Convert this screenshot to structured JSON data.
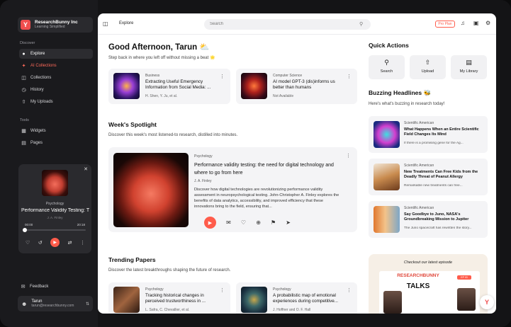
{
  "brand": {
    "logo_letter": "Y",
    "name": "ResearchBunny Inc",
    "tagline": "Learning Simplified"
  },
  "sidebar": {
    "discover_label": "Discover",
    "items": [
      {
        "label": "Explore",
        "icon": "compass-icon"
      },
      {
        "label": "AI Collections",
        "icon": "sparkle-icon"
      },
      {
        "label": "Collections",
        "icon": "folder-icon"
      },
      {
        "label": "History",
        "icon": "history-icon"
      },
      {
        "label": "My Uploads",
        "icon": "upload-icon"
      }
    ],
    "tools_label": "Tools",
    "tools": [
      {
        "label": "Widgets",
        "icon": "widget-icon"
      },
      {
        "label": "Pages",
        "icon": "page-icon"
      }
    ],
    "feedback_label": "Feedback",
    "user": {
      "name": "Tarun",
      "email": "tarun@researchbunny.com"
    }
  },
  "player": {
    "category": "Psychology",
    "title": "Performance Validity Testing: T",
    "author": "J. A. Finley",
    "time_current": "00:00",
    "time_total": "20:18",
    "progress": 0.0
  },
  "topbar": {
    "title": "Explore",
    "search_placeholder": "Search",
    "plan_label": "Pro Plan"
  },
  "greeting": {
    "title": "Good Afternoon, Tarun ⛅",
    "subtitle": "Step back in where you left off without missing a beat 🌟"
  },
  "recent": [
    {
      "category": "Business",
      "title": "Extracting Useful Emergency Information from Social Media: ...",
      "meta": "H. Shen, Y. Ju, et al."
    },
    {
      "category": "Computer Science",
      "title": "AI model GPT-3 (dis)informs us better than humans",
      "meta": "Not Available"
    }
  ],
  "spotlight": {
    "title": "Week's Spotlight",
    "subtitle": "Discover this week's most listened-to research, distilled into minutes.",
    "card": {
      "category": "Psychology",
      "title": "Performance validity testing: the need for digital technology and where to go from here",
      "author": "J. A. Finley",
      "description": "Discover how digital technologies are revolutionizing performance validity assessment in neuropsychological testing. John-Christopher A. Finley explores the benefits of data analytics, accessibility, and improved efficiency that these innovations bring to the field, ensuring that..."
    }
  },
  "trending": {
    "title": "Trending Papers",
    "subtitle": "Discover the latest breakthroughs shaping the future of research.",
    "items": [
      {
        "category": "Psychology",
        "title": "Tracking historical changes in perceived trustworthiness in ...",
        "meta": "L. Safra, C. Chevallier, et al."
      },
      {
        "category": "Psychology",
        "title": "A probabilistic map of emotional experiences during competitive...",
        "meta": "J. Hoffner and O. F. Hall"
      }
    ]
  },
  "quick_actions": {
    "title": "Quick Actions",
    "items": [
      {
        "label": "Search",
        "icon": "search-icon"
      },
      {
        "label": "Upload",
        "icon": "upload-icon"
      },
      {
        "label": "My Library",
        "icon": "library-icon"
      }
    ]
  },
  "headlines": {
    "title": "Buzzing Headlines 🐝",
    "subtitle": "Here's what's buzzing in research today!",
    "items": [
      {
        "source": "Scientific American",
        "title": "What Happens When an Entire Scientific Field Changes Its Mind",
        "desc": "If there is a promising gene for the Ag..."
      },
      {
        "source": "Scientific American",
        "title": "New Treatments Can Free Kids from the Deadly Threat of Peanut Allergy",
        "desc": "Remarkable new treatments can free..."
      },
      {
        "source": "Scientific American",
        "title": "Say Goodbye to Juno, NASA's Groundbreaking Mission to Jupiter",
        "desc": "The Juno spacecraft has rewritten the story..."
      }
    ]
  },
  "episode": {
    "heading": "Checkout our latest episode",
    "brand": "RESEARCHBUNNY",
    "talks": "TALKS",
    "tag": "EP 03"
  },
  "colors": {
    "accent": "#ff5c4b",
    "sidebar_bg": "#1a1a1d",
    "main_bg": "#ffffff"
  }
}
